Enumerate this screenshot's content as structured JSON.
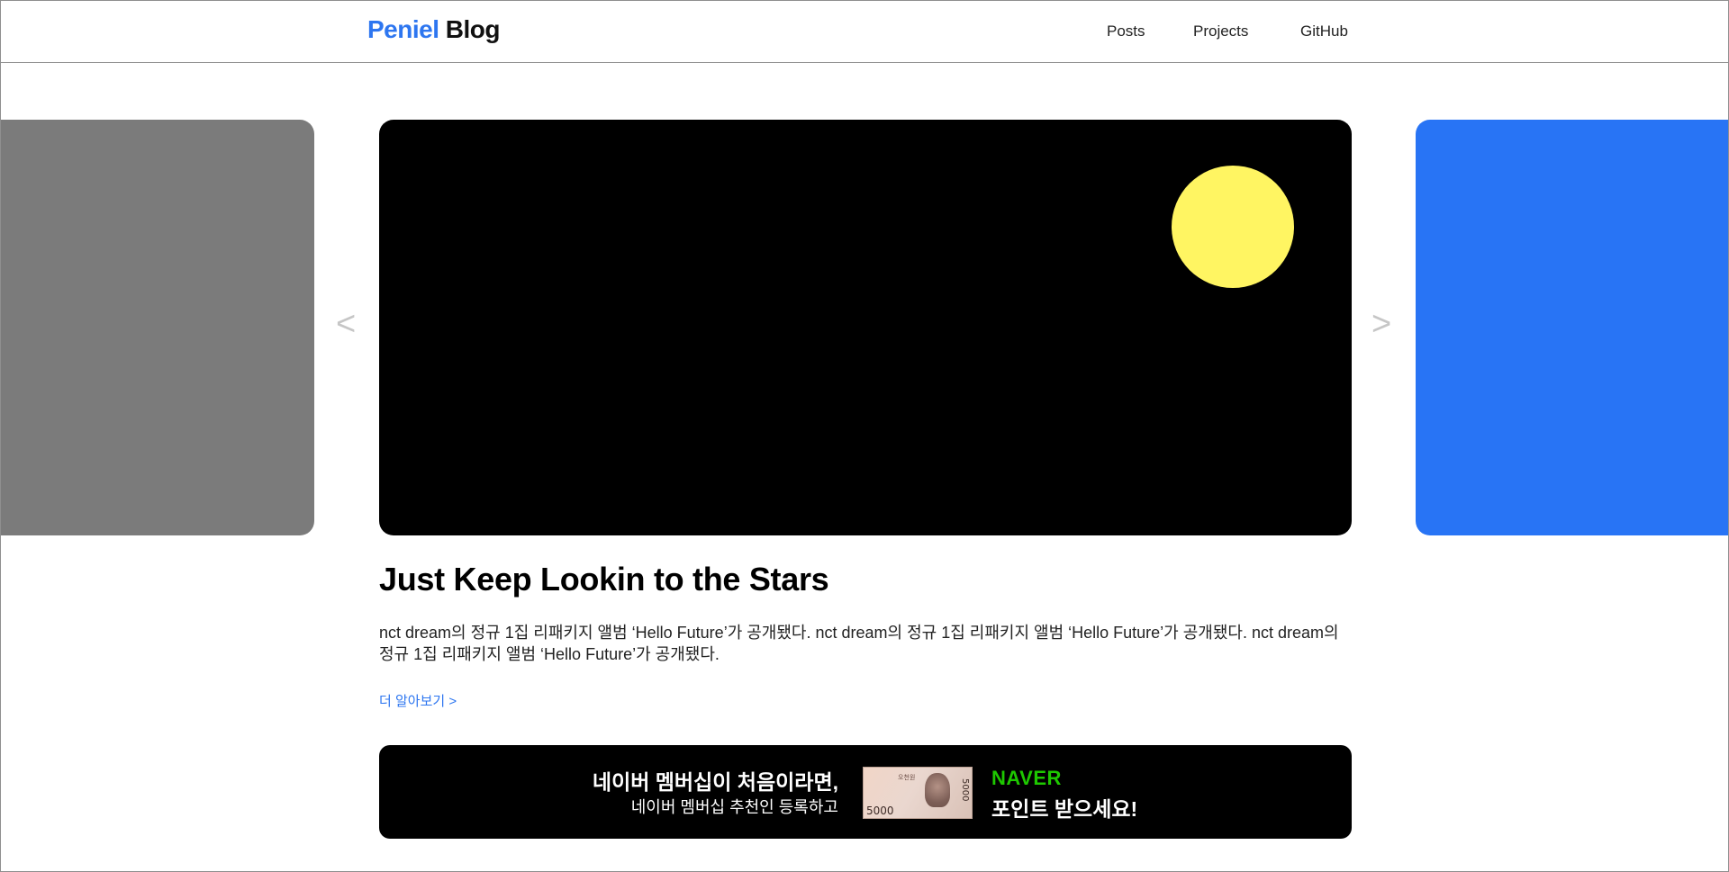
{
  "header": {
    "brand_accent": "Peniel",
    "brand_main": "Blog",
    "nav": [
      {
        "label": "Posts"
      },
      {
        "label": "Projects"
      },
      {
        "label": "GitHub"
      }
    ]
  },
  "carousel": {
    "prev_arrow": "<",
    "next_arrow": ">",
    "colors": {
      "prev_slide": "#7b7b7b",
      "main_slide": "#000000",
      "next_slide": "#2874f5",
      "moon": "#fff562"
    }
  },
  "post": {
    "title": "Just Keep Lookin to the Stars",
    "description": "nct dream의 정규 1집 리패키지 앨범 ‘Hello Future’가 공개됐다. nct dream의 정규 1집 리패키지 앨범 ‘Hello Future’가 공개됐다. nct dream의 정규 1집 리패키지 앨범 ‘Hello Future’가 공개됐다.",
    "more_link": "더 알아보기 >"
  },
  "banner": {
    "line1": "네이버 멤버십이 처음이라면,",
    "line2": "네이버 멤버십 추천인 등록하고",
    "note_value": "5000",
    "note_text": "오천원",
    "naver_logo": "NAVER",
    "cta": "포인트 받으세요!"
  },
  "colors": {
    "accent": "#2d76f0",
    "naver_green": "#1ec800"
  }
}
